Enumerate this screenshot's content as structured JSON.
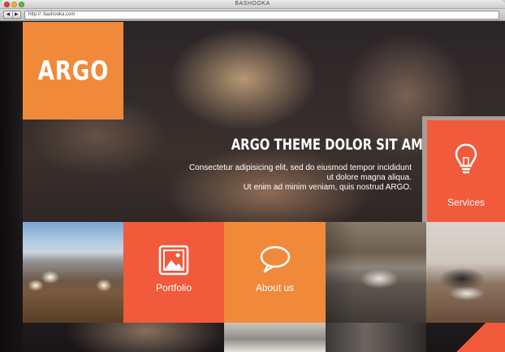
{
  "window": {
    "title": "BASHOOKA",
    "back_icon": "back-arrow-icon",
    "forward_icon": "forward-arrow-icon",
    "nav_back": "◀",
    "nav_forward": "▶",
    "url": "http://. bashooka.com"
  },
  "site": {
    "logo": "ARGO",
    "hero_title": "ARGO THEME DOLOR SIT AMET TELASDE",
    "hero_lines": [
      "Consectetur adipisicing elit, sed do eiusmod tempor incididunt",
      "ut dolore magna aliqua.",
      "Ut enim ad minim veniam, quis nostrud ARGO."
    ],
    "tiles": {
      "services": {
        "label": "Services",
        "icon": "lightbulb-icon"
      },
      "portfolio": {
        "label": "Portfolio",
        "icon": "image-icon"
      },
      "about": {
        "label": "About us",
        "icon": "speech-bubble-icon"
      }
    },
    "colors": {
      "orange": "#f08a3a",
      "red_orange": "#f15a3a"
    }
  }
}
